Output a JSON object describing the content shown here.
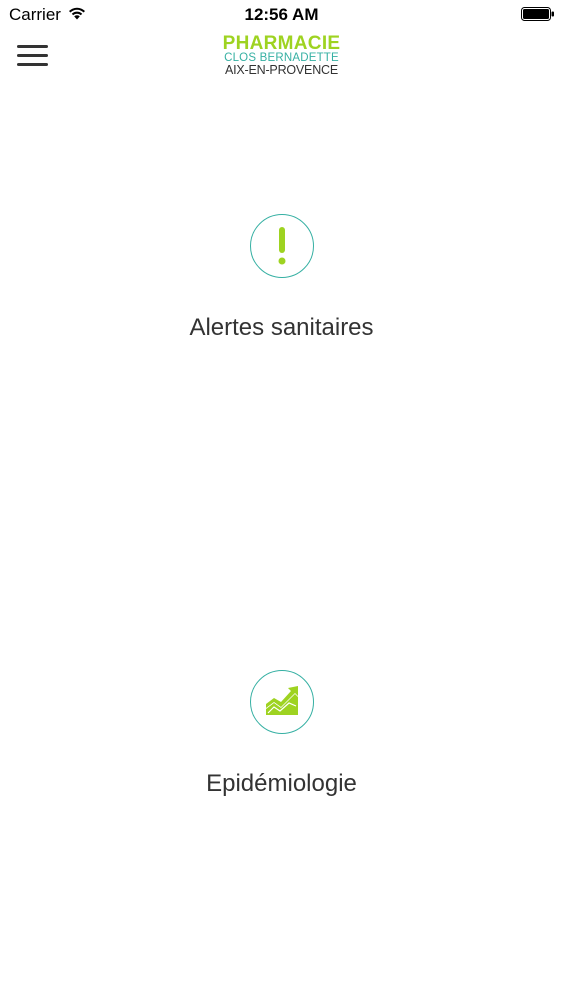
{
  "status_bar": {
    "carrier": "Carrier",
    "time": "12:56 AM",
    "wifi_icon": "wifi-icon",
    "battery_icon": "battery-icon"
  },
  "header": {
    "menu_icon": "hamburger-menu-icon",
    "logo": {
      "line1": "PHARMACIE",
      "line2": "CLOS BERNADETTE",
      "line3": "AIX-EN-PROVENCE"
    }
  },
  "menu": [
    {
      "label": "Alertes sanitaires",
      "icon": "exclamation-icon"
    },
    {
      "label": "Epidémiologie",
      "icon": "trend-chart-icon"
    }
  ],
  "colors": {
    "brand_green": "#9ed321",
    "brand_teal": "#36b0a3",
    "text": "#333333"
  }
}
